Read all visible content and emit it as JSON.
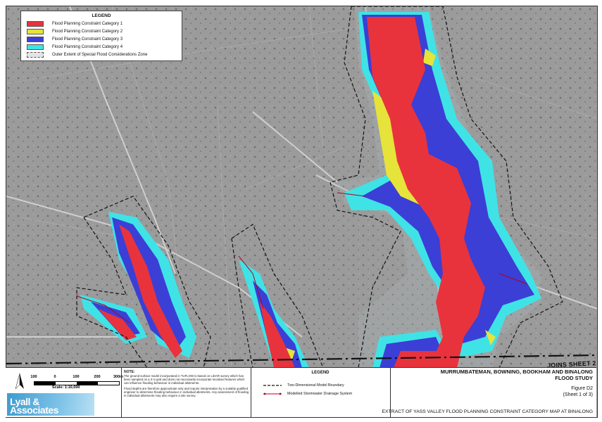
{
  "legend": {
    "title": "LEGEND",
    "items": [
      {
        "label": "Flood Planning Constraint Category 1",
        "color": "#e8333d"
      },
      {
        "label": "Flood Planning Constraint Category 2",
        "color": "#e6e33a"
      },
      {
        "label": "Flood Planning Constraint Category 3",
        "color": "#3b3fd6"
      },
      {
        "label": "Flood Planning Constraint Category 4",
        "color": "#3fe3e6"
      },
      {
        "label": "Outer Extent of Special Flood Considerations Zone",
        "color": "#c9c9c9"
      }
    ]
  },
  "map": {
    "joins_label": "JOINS SHEET 2",
    "colors": {
      "cat1": "#e8333d",
      "cat2": "#e6e33a",
      "cat3": "#3b3fd6",
      "cat4": "#3fe3e6",
      "background": "#9a9a9a",
      "road": "#c8c8c8"
    }
  },
  "titleblock": {
    "scale": {
      "ticks": [
        "100",
        "0",
        "100",
        "200",
        "300m"
      ],
      "label": "Scale: 1:10,000"
    },
    "logo": {
      "line1": "Lyall &",
      "line2": "Associates"
    },
    "note": {
      "heading": "NOTE:",
      "p1": "The ground surface model incorporated in TUFLOW is based on LiDAR survey which has been sampled on a 3 m grid and does not necessarily incorporate localised features which can influence flooding behaviour in individual allotments.",
      "p2": "Flood depths are therefore approximate only and require interpretation by a suitably qualified engineer to determine flooding behaviour in individual allotments. Any assessment of flooding in individual allotments may also require a site survey."
    },
    "legend": {
      "title": "LEGEND",
      "items": [
        {
          "label": "Two-Dimensional Model Boundary"
        },
        {
          "label": "Modelled Stormwater Drainage System"
        }
      ]
    },
    "study": {
      "line1": "MURRUMBATEMAN, BOWNING, BOOKHAM AND BINALONG",
      "line2": "FLOOD STUDY"
    },
    "figure": {
      "line1": "Figure D2",
      "line2": "(Sheet 1 of 3)"
    },
    "caption": "EXTRACT OF YASS VALLEY FLOOD PLANNING CONSTRAINT CATEGORY MAP AT BINALONG"
  }
}
